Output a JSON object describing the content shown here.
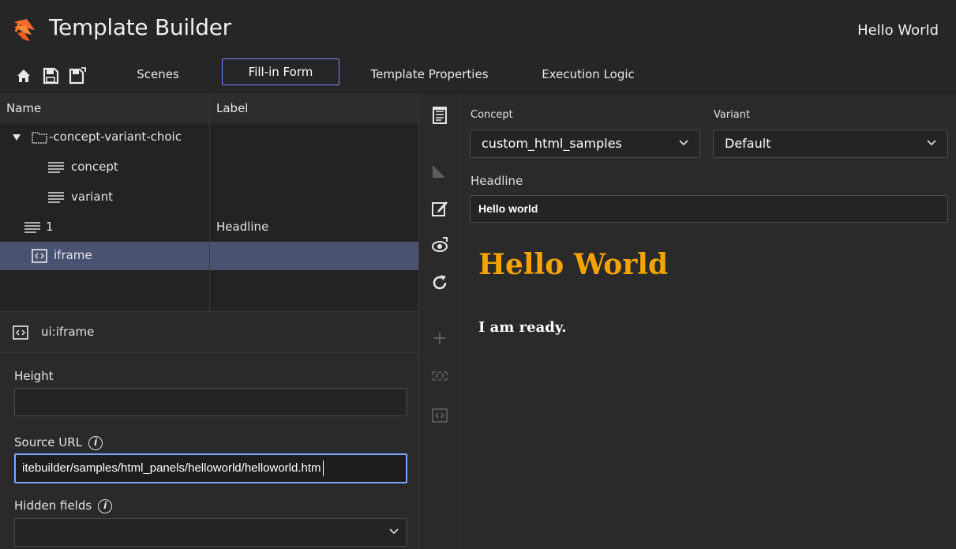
{
  "app": {
    "title": "Template Builder",
    "document_title": "Hello World"
  },
  "toolbar": {
    "icons": [
      "home-icon",
      "save-icon",
      "save-as-icon"
    ],
    "tabs": [
      {
        "label": "Scenes",
        "active": false
      },
      {
        "label": "Fill-in Form",
        "active": true
      },
      {
        "label": "Template Properties",
        "active": false
      },
      {
        "label": "Execution Logic",
        "active": false
      }
    ],
    "accent_color": "#6f8fff"
  },
  "tree": {
    "columns": [
      "Name",
      "Label"
    ],
    "rows": [
      {
        "name": "-concept-variant-choic",
        "label": "",
        "icon": "folder-icon",
        "expanded": true
      },
      {
        "name": "concept",
        "label": "",
        "icon": "lines-icon"
      },
      {
        "name": "variant",
        "label": "",
        "icon": "lines-icon"
      },
      {
        "name": "1",
        "label": "Headline",
        "icon": "lines-icon"
      },
      {
        "name": "iframe",
        "label": "",
        "icon": "iframe-icon",
        "selected": true
      }
    ],
    "selected_color": "#4a5272"
  },
  "properties": {
    "type": "ui:iframe",
    "height_label": "Height",
    "height_value": "",
    "source_label": "Source URL",
    "source_value": "itebuilder/samples/html_panels/helloworld/helloworld.htm",
    "hidden_label": "Hidden fields",
    "hidden_value": ""
  },
  "side_icons": [
    "form-icon",
    "ruler-icon",
    "edit-icon",
    "preview-icon",
    "refresh-icon",
    "add-icon",
    "code-icon",
    "iframe-icon"
  ],
  "form": {
    "concept_label": "Concept",
    "concept_value": "custom_html_samples",
    "variant_label": "Variant",
    "variant_value": "Default",
    "headline_label": "Headline",
    "headline_value": "Hello world"
  },
  "preview": {
    "heading": "Hello World",
    "body": "I am ready.",
    "heading_color": "#f5a300"
  }
}
